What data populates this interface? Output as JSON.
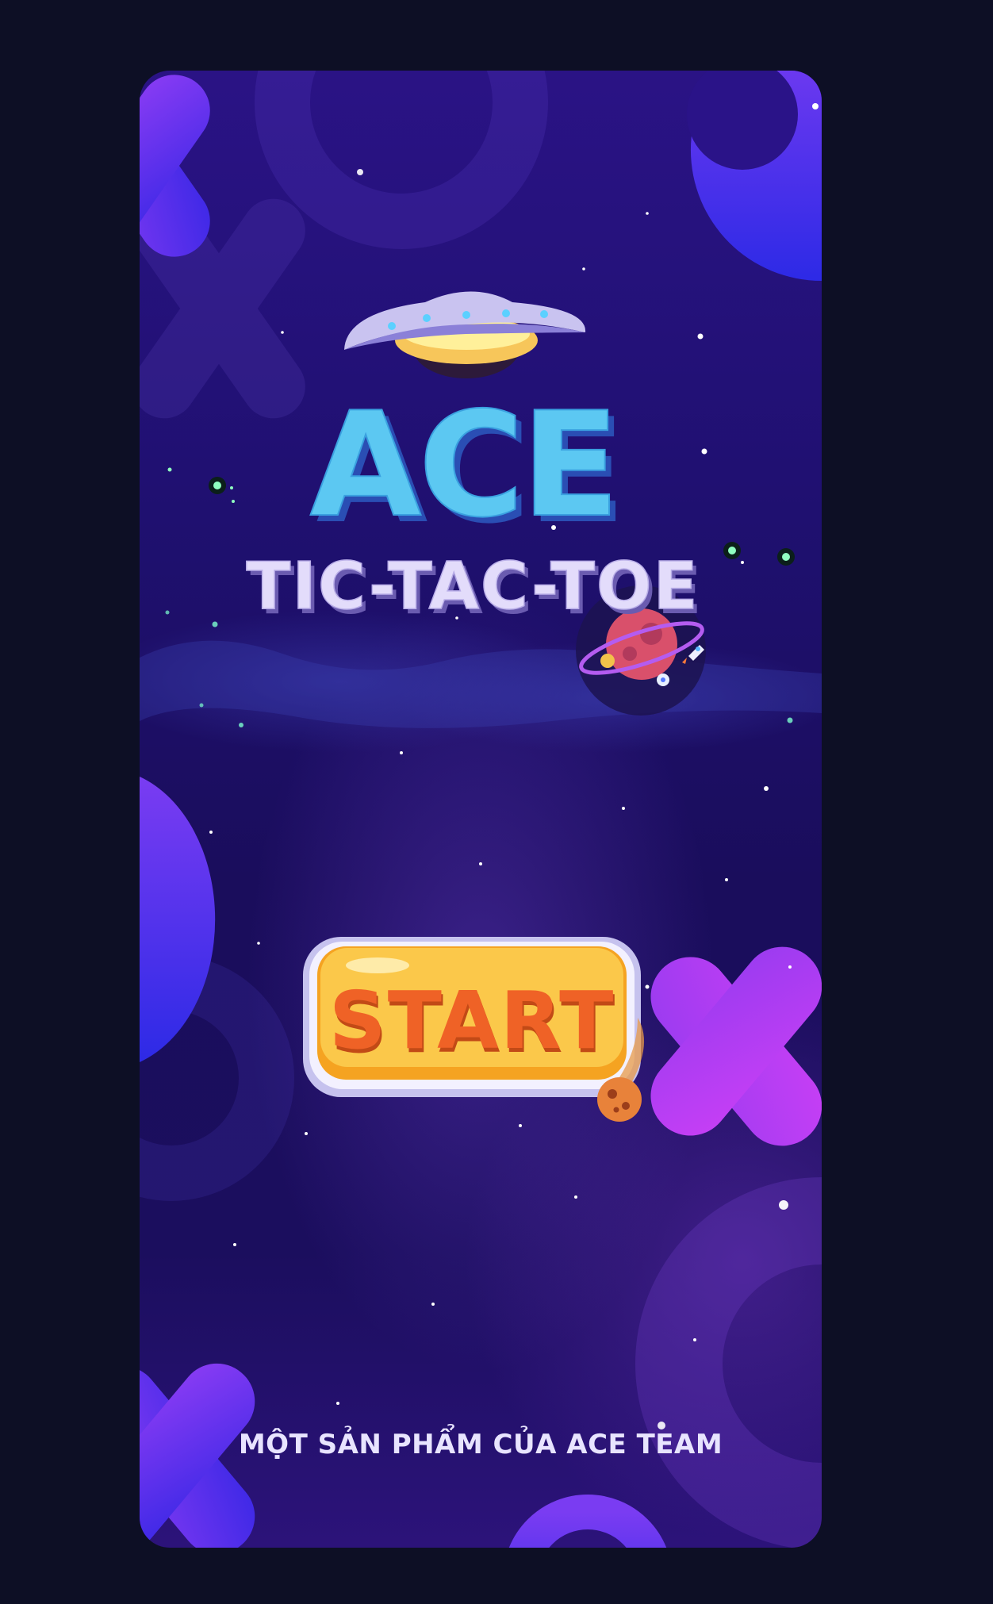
{
  "title": {
    "main": "ACE",
    "subtitle": "TIC-TAC-TOE"
  },
  "start_button": {
    "label": "START"
  },
  "footer": {
    "credit": "MỘT SẢN PHẨM CỦA ACE TEAM"
  },
  "colors": {
    "page_background": "#0d0f25",
    "space_top": "#2a1385",
    "space_bottom": "#1a0d5c",
    "ace_text": "#5cc8f2",
    "subtitle_text": "#e3dcfb",
    "start_button_fill": "#f9b83a",
    "start_label": "#ef6226",
    "credit_text": "#e8e4ff",
    "piece_blue": "#3a2be8",
    "piece_purple": "#b03af0"
  },
  "icons": [
    "ufo-icon",
    "planet-icon",
    "rocket-icon",
    "meteor-icon",
    "star-icon"
  ]
}
